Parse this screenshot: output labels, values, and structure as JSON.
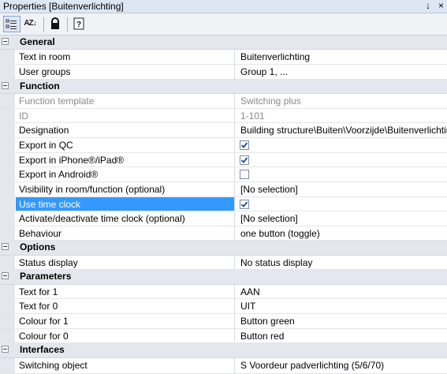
{
  "window": {
    "title": "Properties [Buitenverlichting]",
    "pin_glyph": "↓",
    "close_glyph": "×"
  },
  "toolbar": {
    "categorized_icon": "categorized-icon",
    "sort_az_icon": "sort-alphabetical-icon",
    "lock_icon": "lock-icon",
    "help_icon": "help-icon",
    "sort_glyph": "AZ↓",
    "lock_glyph": "🔒",
    "help_glyph": "?"
  },
  "colors": {
    "selection": "#3399ff",
    "category_bg": "#e4e8ee",
    "check": "#1c4f9c"
  },
  "sections": {
    "general": {
      "label": "General",
      "text_in_room": {
        "name": "Text in room",
        "value": "Buitenverlichting"
      },
      "user_groups": {
        "name": "User groups",
        "value": "Group  1, ..."
      }
    },
    "function": {
      "label": "Function",
      "function_template": {
        "name": "Function template",
        "value": "Switching plus"
      },
      "id": {
        "name": "ID",
        "value": "1-101"
      },
      "designation": {
        "name": "Designation",
        "value": "Building structure\\Buiten\\Voorzijde\\Buitenverlichtin"
      },
      "export_qc": {
        "name": "Export in QC",
        "checked": true
      },
      "export_iphone": {
        "name": "Export in iPhone®/iPad®",
        "checked": true
      },
      "export_android": {
        "name": "Export in Android®",
        "checked": false
      },
      "visibility": {
        "name": "Visibility in room/function (optional)",
        "value": "[No selection]"
      },
      "use_time_clock": {
        "name": "Use time clock",
        "checked": true
      },
      "activate_time_clock": {
        "name": "Activate/deactivate time clock (optional)",
        "value": "[No selection]"
      },
      "behaviour": {
        "name": "Behaviour",
        "value": "one button (toggle)"
      }
    },
    "options": {
      "label": "Options",
      "status_display": {
        "name": "Status display",
        "value": "No status display"
      }
    },
    "parameters": {
      "label": "Parameters",
      "text_for_1": {
        "name": "Text for 1",
        "value": "AAN"
      },
      "text_for_0": {
        "name": "Text for 0",
        "value": "UIT"
      },
      "colour_for_1": {
        "name": "Colour for 1",
        "value": "Button green"
      },
      "colour_for_0": {
        "name": "Colour for 0",
        "value": "Button red"
      }
    },
    "interfaces": {
      "label": "Interfaces",
      "switching_object": {
        "name": "Switching object",
        "value": "S Voordeur padverlichting (5/6/70)"
      }
    }
  }
}
